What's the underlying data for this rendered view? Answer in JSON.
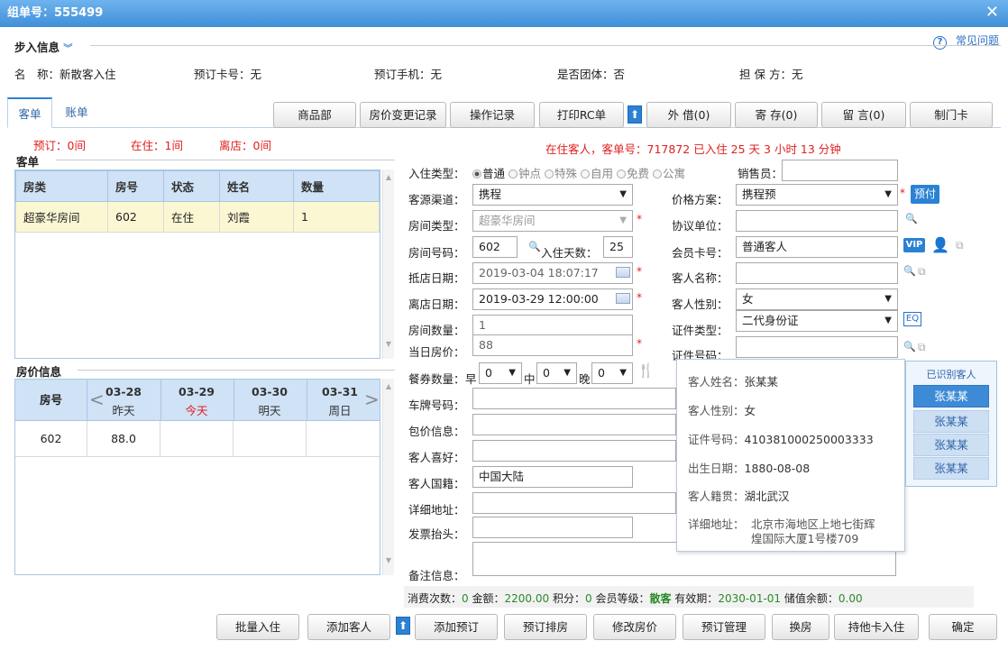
{
  "window": {
    "title": "组单号：555499"
  },
  "help": {
    "label": "常见问题"
  },
  "step_info": {
    "title": "步入信息",
    "name_label": "名　称：",
    "name_value": "新散客入住",
    "card_label": "预订卡号：",
    "card_value": "无",
    "phone_label": "预订手机：",
    "phone_value": "无",
    "group_label": "是否团体：",
    "group_value": "否",
    "guarantor_label": "担 保 方：",
    "guarantor_value": "无"
  },
  "tabs": [
    {
      "label": "客单"
    },
    {
      "label": "账单"
    }
  ],
  "toolbar": {
    "items": [
      {
        "label": "商品部"
      },
      {
        "label": "房价变更记录"
      },
      {
        "label": "操作记录"
      },
      {
        "label": "打印RC单"
      },
      {
        "label": "外 借(0)"
      },
      {
        "label": "寄 存(0)"
      },
      {
        "label": "留 言(0)"
      },
      {
        "label": "制门卡"
      }
    ]
  },
  "status": {
    "reserved": "预订：0间",
    "inhouse": "在住：1间",
    "checkout": "离店：0间"
  },
  "guest_notice": "在住客人，客单号：717872 已入住 25 天 3 小时 13 分钟",
  "guest_list": {
    "title": "客单",
    "columns": [
      "房类",
      "房号",
      "状态",
      "姓名",
      "数量"
    ],
    "rows": [
      [
        "超豪华房间",
        "602",
        "在住",
        "刘霞",
        "1"
      ]
    ]
  },
  "price_info": {
    "title": "房价信息",
    "col_room": "房号",
    "days": [
      {
        "date": "03-28",
        "sub": "昨天"
      },
      {
        "date": "03-29",
        "sub": "今天"
      },
      {
        "date": "03-30",
        "sub": "明天"
      },
      {
        "date": "03-31",
        "sub": "周日"
      }
    ],
    "rows": [
      {
        "room": "602",
        "price": "88.0"
      }
    ]
  },
  "form": {
    "checkin_type_label": "入住类型：",
    "checkin_types": [
      "普通",
      "钟点",
      "特殊",
      "自用",
      "免费",
      "公寓"
    ],
    "sales_label": "销售员：",
    "source_label": "客源渠道：",
    "source_value": "携程",
    "price_plan_label": "价格方案：",
    "price_plan_value": "携程预",
    "prepay_label": "预付",
    "room_type_label": "房间类型：",
    "room_type_value": "超豪华房间",
    "agreement_label": "协议单位：",
    "room_no_label": "房间号码：",
    "room_no_value": "602",
    "days_label": "入住天数：",
    "days_value": "25",
    "member_card_label": "会员卡号：",
    "member_card_value": "普通客人",
    "vip_label": "VIP",
    "arrive_label": "抵店日期：",
    "arrive_value": "2019-03-04 18:07:17",
    "guest_name_label": "客人名称：",
    "leave_label": "离店日期：",
    "leave_value": "2019-03-29 12:00:00",
    "gender_label": "客人性别：",
    "gender_value": "女",
    "room_count_label": "房间数量：",
    "room_count_value": "1",
    "id_type_label": "证件类型：",
    "id_type_value": "二代身份证",
    "day_price_label": "当日房价：",
    "day_price_value": "88",
    "id_no_label": "证件号码：",
    "meal_label": "餐券数量：",
    "breakfast_label": "早",
    "lunch_label": "中",
    "dinner_label": "晚",
    "meal_b": "0",
    "meal_l": "0",
    "meal_d": "0",
    "plate_label": "车牌号码：",
    "package_label": "包价信息：",
    "preference_label": "客人喜好：",
    "nation_label": "客人国籍：",
    "nation_value": "中国大陆",
    "address_label": "详细地址：",
    "invoice_label": "发票抬头：",
    "remark_label": "备注信息："
  },
  "popup": {
    "name_label": "客人姓名：",
    "name_value": "张某某",
    "gender_label": "客人性别：",
    "gender_value": "女",
    "id_label": "证件号码：",
    "id_value": "410381000250003333",
    "birth_label": "出生日期：",
    "birth_value": "1880-08-08",
    "origin_label": "客人籍贯：",
    "origin_value": "湖北武汉",
    "addr_label": "详细地址：",
    "addr_line1": "北京市海地区上地七街辉",
    "addr_line2": "煌国际大厦1号楼709"
  },
  "recognized": {
    "title": "已识别客人",
    "items": [
      "张某某",
      "张某某",
      "张某某",
      "张某某"
    ]
  },
  "summary": {
    "count_label": "消费次数：",
    "count_value": "0",
    "amount_label": "金额：",
    "amount_value": "2200.00",
    "points_label": "积分：",
    "points_value": "0",
    "level_label": "会员等级：",
    "level_value": "散客",
    "valid_label": "有效期：",
    "valid_value": "2030-01-01",
    "balance_label": "储值余额：",
    "balance_value": "0.00"
  },
  "bottom_buttons": [
    {
      "label": "批量入住"
    },
    {
      "label": "添加客人"
    },
    {
      "label": "添加预订"
    },
    {
      "label": "预订排房"
    },
    {
      "label": "修改房价"
    },
    {
      "label": "预订管理"
    },
    {
      "label": "换房"
    },
    {
      "label": "持他卡入住"
    },
    {
      "label": "确定"
    }
  ]
}
